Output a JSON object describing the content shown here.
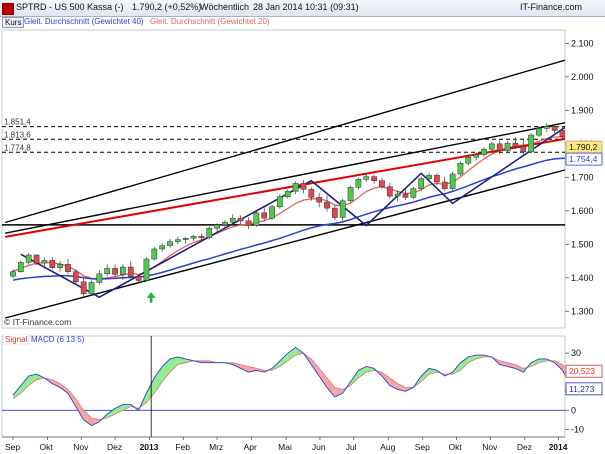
{
  "header": {
    "symbol": "SPTRD - US 500 Kassa (-)",
    "last": "1.790,2 (+0,52%)",
    "period": "Wöchentlich",
    "timestamp": "28 Jan 2014 10:31 (09:31)",
    "source": "IT-Finance.com"
  },
  "legend": {
    "kurs": "Kurs",
    "ma40": "Gleit. Durchschnitt (Gewichtet 40)",
    "ma20": "Gleit. Durchschnitt (Gewichtet 20)"
  },
  "watermark": "© IT-Finance.com",
  "macd_legend": {
    "signal": "Signal",
    "macd": "MACD (6 13 5)"
  },
  "colors": {
    "up_candle": "#4ec94e",
    "down_candle": "#e0474c",
    "ma40": "#2a3fd0",
    "ma20": "#e06060",
    "trend_red": "#e00000",
    "zigzag": "#1a237e",
    "channel": "#000000",
    "macd_fill_up": "#90ee90",
    "macd_fill_down": "#f4a6a6",
    "macd_line": "#2a3fd0"
  },
  "chart_data": [
    {
      "type": "candlestick",
      "title": "SPTRD - US 500 Kassa (-)",
      "period": "weekly",
      "ylim": [
        1250,
        2140
      ],
      "y_ticks": [
        "1.300",
        "1.400",
        "1.500",
        "1.600",
        "1.700",
        "1.800",
        "1.900",
        "2.000",
        "2.100"
      ],
      "x_ticks": [
        "Sep",
        "Okt",
        "Nov",
        "Dez",
        "2013",
        "Feb",
        "Mrz",
        "Apr",
        "Mai",
        "Jun",
        "Jul",
        "Aug",
        "Sep",
        "Okt",
        "Nov",
        "Dez",
        "2014"
      ],
      "x_tick_weeks": [
        0,
        4.4,
        8.7,
        13,
        17.4,
        21.7,
        26,
        30.4,
        34.8,
        39.1,
        43.4,
        47.8,
        52.2,
        56.5,
        60.8,
        65.2,
        69.5
      ],
      "price_labels": [
        {
          "text": "1.790,2",
          "value": 1790.2
        },
        {
          "text": "1.754,4",
          "value": 1754.4
        }
      ],
      "horizontal_levels": [
        {
          "text": "1.851,4",
          "value": 1851.4,
          "style": "dashed"
        },
        {
          "text": "1.813,6",
          "value": 1813.6,
          "style": "dashed"
        },
        {
          "text": "1.774,8",
          "value": 1774.8,
          "style": "dashed"
        },
        {
          "text": "",
          "value": 1558,
          "style": "solid"
        }
      ],
      "candles": [
        [
          1405,
          1425,
          1398,
          1418
        ],
        [
          1418,
          1452,
          1415,
          1446
        ],
        [
          1446,
          1474,
          1440,
          1468
        ],
        [
          1468,
          1470,
          1438,
          1444
        ],
        [
          1444,
          1460,
          1428,
          1452
        ],
        [
          1452,
          1462,
          1424,
          1430
        ],
        [
          1430,
          1450,
          1418,
          1440
        ],
        [
          1440,
          1456,
          1410,
          1418
        ],
        [
          1418,
          1426,
          1380,
          1388
        ],
        [
          1388,
          1400,
          1342,
          1352
        ],
        [
          1352,
          1392,
          1346,
          1386
        ],
        [
          1386,
          1422,
          1380,
          1412
        ],
        [
          1412,
          1440,
          1404,
          1428
        ],
        [
          1428,
          1440,
          1402,
          1410
        ],
        [
          1410,
          1440,
          1394,
          1432
        ],
        [
          1432,
          1450,
          1398,
          1404
        ],
        [
          1404,
          1408,
          1384,
          1392
        ],
        [
          1392,
          1462,
          1388,
          1456
        ],
        [
          1456,
          1492,
          1452,
          1486
        ],
        [
          1486,
          1502,
          1478,
          1496
        ],
        [
          1496,
          1516,
          1490,
          1508
        ],
        [
          1508,
          1522,
          1500,
          1514
        ],
        [
          1514,
          1522,
          1502,
          1518
        ],
        [
          1518,
          1528,
          1510,
          1524
        ],
        [
          1524,
          1532,
          1508,
          1520
        ],
        [
          1520,
          1554,
          1514,
          1548
        ],
        [
          1548,
          1562,
          1532,
          1558
        ],
        [
          1558,
          1572,
          1548,
          1566
        ],
        [
          1566,
          1590,
          1556,
          1578
        ],
        [
          1578,
          1586,
          1560,
          1570
        ],
        [
          1570,
          1580,
          1546,
          1556
        ],
        [
          1556,
          1600,
          1552,
          1594
        ],
        [
          1594,
          1610,
          1568,
          1578
        ],
        [
          1578,
          1618,
          1572,
          1612
        ],
        [
          1612,
          1650,
          1606,
          1642
        ],
        [
          1642,
          1664,
          1636,
          1658
        ],
        [
          1658,
          1688,
          1650,
          1682
        ],
        [
          1682,
          1692,
          1652,
          1664
        ],
        [
          1664,
          1670,
          1630,
          1640
        ],
        [
          1640,
          1654,
          1610,
          1626
        ],
        [
          1626,
          1646,
          1598,
          1608
        ],
        [
          1608,
          1618,
          1572,
          1580
        ],
        [
          1580,
          1636,
          1570,
          1630
        ],
        [
          1630,
          1676,
          1624,
          1670
        ],
        [
          1670,
          1700,
          1664,
          1694
        ],
        [
          1694,
          1712,
          1686,
          1702
        ],
        [
          1702,
          1708,
          1680,
          1690
        ],
        [
          1690,
          1698,
          1664,
          1672
        ],
        [
          1672,
          1684,
          1636,
          1644
        ],
        [
          1644,
          1660,
          1628,
          1650
        ],
        [
          1650,
          1666,
          1632,
          1640
        ],
        [
          1640,
          1672,
          1636,
          1666
        ],
        [
          1666,
          1702,
          1660,
          1696
        ],
        [
          1696,
          1714,
          1686,
          1706
        ],
        [
          1706,
          1712,
          1676,
          1686
        ],
        [
          1686,
          1702,
          1660,
          1666
        ],
        [
          1666,
          1716,
          1660,
          1710
        ],
        [
          1710,
          1748,
          1704,
          1742
        ],
        [
          1742,
          1766,
          1736,
          1760
        ],
        [
          1760,
          1774,
          1750,
          1768
        ],
        [
          1768,
          1790,
          1762,
          1784
        ],
        [
          1784,
          1806,
          1776,
          1800
        ],
        [
          1800,
          1810,
          1770,
          1780
        ],
        [
          1780,
          1808,
          1772,
          1802
        ],
        [
          1802,
          1820,
          1784,
          1792
        ],
        [
          1792,
          1812,
          1762,
          1776
        ],
        [
          1776,
          1832,
          1772,
          1826
        ],
        [
          1826,
          1852,
          1820,
          1846
        ],
        [
          1846,
          1862,
          1836,
          1852
        ],
        [
          1852,
          1860,
          1832,
          1840
        ],
        [
          1840,
          1854,
          1812,
          1822
        ],
        [
          1822,
          1828,
          1768,
          1790
        ]
      ],
      "ma40": [
        1393,
        1397,
        1400,
        1402,
        1404,
        1405,
        1406,
        1406,
        1404,
        1400,
        1397,
        1396,
        1397,
        1398,
        1400,
        1401,
        1402,
        1405,
        1410,
        1416,
        1423,
        1430,
        1437,
        1444,
        1451,
        1457,
        1464,
        1471,
        1478,
        1485,
        1491,
        1498,
        1504,
        1511,
        1518,
        1526,
        1534,
        1542,
        1549,
        1555,
        1559,
        1562,
        1567,
        1574,
        1582,
        1590,
        1597,
        1604,
        1610,
        1615,
        1620,
        1626,
        1633,
        1640,
        1646,
        1651,
        1658,
        1666,
        1675,
        1684,
        1693,
        1702,
        1709,
        1717,
        1725,
        1731,
        1738,
        1745,
        1751,
        1755,
        1757,
        1756
      ],
      "ma20": [
        1420,
        1428,
        1437,
        1443,
        1446,
        1445,
        1441,
        1435,
        1422,
        1406,
        1398,
        1397,
        1400,
        1403,
        1409,
        1413,
        1410,
        1418,
        1433,
        1449,
        1466,
        1481,
        1494,
        1505,
        1513,
        1523,
        1533,
        1543,
        1552,
        1558,
        1560,
        1566,
        1570,
        1579,
        1592,
        1607,
        1622,
        1632,
        1636,
        1636,
        1630,
        1617,
        1615,
        1623,
        1640,
        1658,
        1668,
        1672,
        1665,
        1658,
        1652,
        1653,
        1663,
        1677,
        1682,
        1679,
        1685,
        1701,
        1720,
        1738,
        1755,
        1770,
        1778,
        1787,
        1794,
        1796,
        1799,
        1807,
        1816,
        1820,
        1821,
        1815
      ],
      "trend_lines": [
        {
          "name": "upper_channel",
          "points": [
            [
              -1,
              1565
            ],
            [
              74,
              2075
            ]
          ]
        },
        {
          "name": "channel_mid",
          "points": [
            [
              -1,
              1533
            ],
            [
              74,
              1880
            ]
          ]
        },
        {
          "name": "lower_channel",
          "points": [
            [
              -1,
              1280
            ],
            [
              74,
              1745
            ]
          ]
        },
        {
          "name": "red_trend",
          "points": [
            [
              -1,
              1522
            ],
            [
              74,
              1830
            ]
          ]
        },
        {
          "name": "zigzag",
          "points": [
            [
              1,
              1470
            ],
            [
              11,
              1342
            ],
            [
              38,
              1690
            ],
            [
              45,
              1556
            ],
            [
              52,
              1712
            ],
            [
              56,
              1622
            ],
            [
              71,
              1860
            ]
          ]
        }
      ],
      "annotation_weeks": [
        {
          "name": "arrow",
          "week": 17.6,
          "value": 1338
        }
      ]
    },
    {
      "type": "area",
      "title": "MACD (6 13 5)",
      "ylim": [
        -14,
        39
      ],
      "y_ticks": [
        "-10",
        "0",
        "10",
        "20",
        "30"
      ],
      "end_labels": [
        {
          "text": "20,523",
          "value": 20.523,
          "color": "#d33"
        },
        {
          "text": "11,273",
          "value": 11.273,
          "color": "#23a"
        }
      ],
      "series": [
        {
          "name": "MACD",
          "values": [
            8,
            13,
            18,
            19,
            17,
            14,
            12,
            9,
            2,
            -5,
            -8,
            -6,
            -2,
            1,
            3,
            3,
            0,
            9,
            17,
            23,
            27,
            28,
            27,
            26,
            25,
            25,
            25,
            25,
            24,
            22,
            20,
            21,
            20,
            22,
            26,
            30,
            33,
            30,
            24,
            18,
            12,
            7,
            9,
            15,
            21,
            23,
            22,
            18,
            13,
            11,
            10,
            12,
            18,
            22,
            21,
            18,
            20,
            25,
            28,
            29,
            29,
            28,
            24,
            23,
            22,
            20,
            25,
            27,
            27,
            25,
            21,
            13
          ]
        },
        {
          "name": "Signal",
          "values": [
            6,
            9,
            13,
            16,
            17,
            16,
            14,
            11,
            6,
            0,
            -4,
            -5,
            -4,
            -2,
            0,
            2,
            1,
            4,
            9,
            15,
            20,
            24,
            25,
            26,
            26,
            26,
            25,
            25,
            25,
            24,
            23,
            22,
            21,
            21,
            23,
            26,
            29,
            30,
            27,
            22,
            17,
            12,
            11,
            13,
            17,
            20,
            21,
            20,
            17,
            14,
            12,
            12,
            15,
            19,
            20,
            19,
            19,
            21,
            25,
            27,
            28,
            28,
            26,
            25,
            24,
            22,
            23,
            25,
            26,
            26,
            24,
            20
          ]
        }
      ],
      "vline_week": 17.6
    }
  ]
}
